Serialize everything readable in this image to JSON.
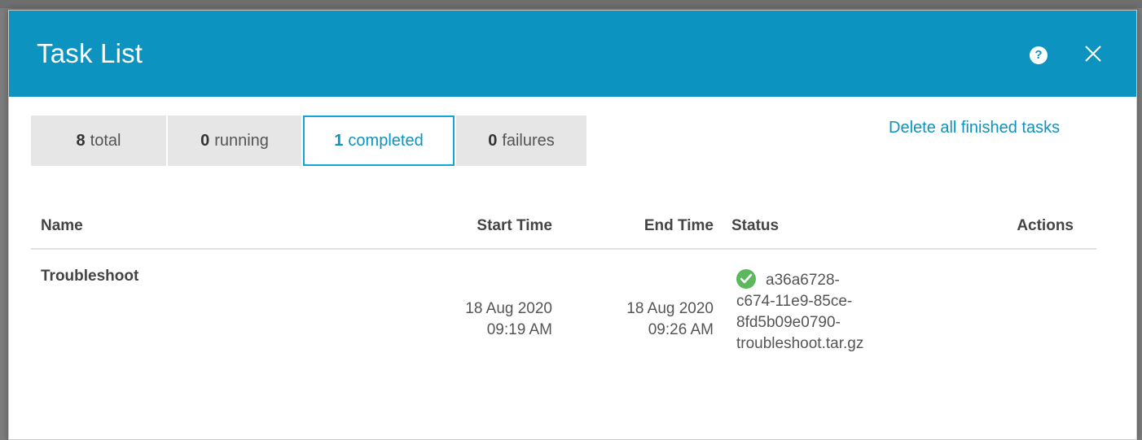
{
  "dialog": {
    "title": "Task List"
  },
  "filters": {
    "total": {
      "count": "8",
      "label": "total"
    },
    "running": {
      "count": "0",
      "label": "running"
    },
    "completed": {
      "count": "1",
      "label": "completed"
    },
    "failures": {
      "count": "0",
      "label": "failures"
    }
  },
  "delete_all_label": "Delete all finished tasks",
  "table": {
    "headers": {
      "name": "Name",
      "start": "Start Time",
      "end": "End Time",
      "status": "Status",
      "actions": "Actions"
    },
    "rows": [
      {
        "name": "Troubleshoot",
        "start_date": "18 Aug 2020",
        "start_time": "09:19 AM",
        "end_date": "18 Aug 2020",
        "end_time": "09:26 AM",
        "status_line1": "a36a6728-",
        "status_line2": "c674-11e9-85ce-",
        "status_line3": "8fd5b09e0790-",
        "status_line4": "troubleshoot.tar.gz"
      }
    ]
  },
  "colors": {
    "header": "#0d93bf",
    "accent": "#12a6d8",
    "success": "#5cb85c"
  },
  "icons": {
    "help": "help-icon",
    "close": "close-icon",
    "status": "check-circle-icon"
  }
}
